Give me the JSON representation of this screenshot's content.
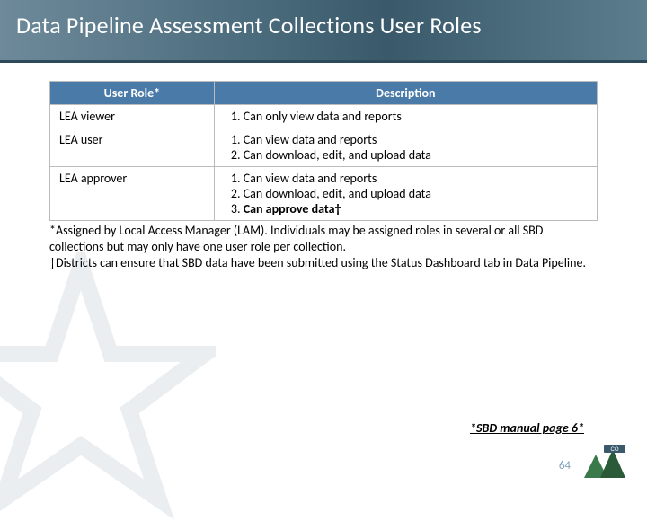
{
  "title": "Data Pipeline Assessment Collections User Roles",
  "table": {
    "headers": {
      "col1": "User Role*",
      "col2": "Description"
    },
    "rows": [
      {
        "role": "LEA viewer",
        "desc": [
          "Can only view data and reports"
        ]
      },
      {
        "role": "LEA user",
        "desc": [
          "Can view data and reports",
          "Can download, edit, and upload data"
        ]
      },
      {
        "role": "LEA approver",
        "desc": [
          "Can view data and reports",
          "Can download, edit, and upload data",
          "Can approve data†"
        ]
      }
    ]
  },
  "footnotes": [
    "*Assigned by Local Access Manager (LAM). Individuals may be assigned roles in several or all SBD collections but may only have one user role per collection.",
    "†Districts can ensure that SBD data have been submitted using the Status Dashboard tab in Data Pipeline."
  ],
  "ref": "*SBD manual page 6*",
  "page": "64",
  "logo_alt": "CO"
}
